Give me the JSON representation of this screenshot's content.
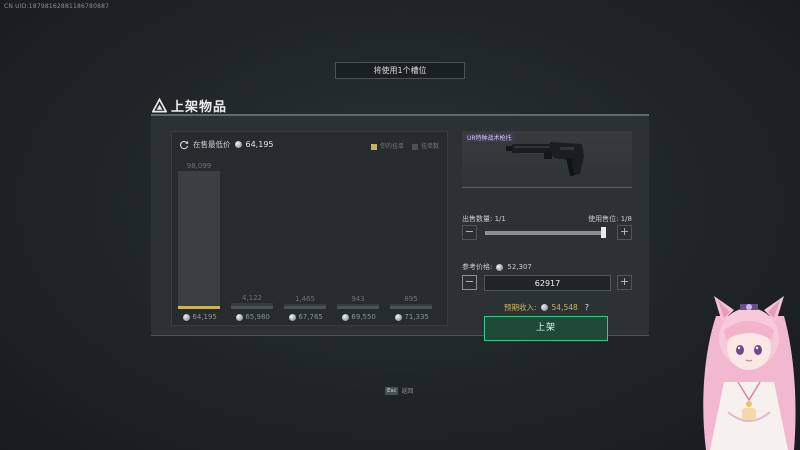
{
  "uid": "CN UID:18798162881186780887",
  "slot_notice": "将使用1个槽位",
  "panel_title": "上架物品",
  "chart": {
    "header_label": "在售最低价",
    "header_price": "64,195",
    "legend_own": "你的挂单",
    "legend_other": "挂单数",
    "bars": [
      {
        "count": "98,099",
        "price": "64,195",
        "own": true,
        "fill": 1.0
      },
      {
        "count": "4,122",
        "price": "65,980",
        "own": false,
        "fill": 0.042
      },
      {
        "count": "1,465",
        "price": "67,765",
        "own": false,
        "fill": 0.015
      },
      {
        "count": "943",
        "price": "69,550",
        "own": false,
        "fill": 0.01
      },
      {
        "count": "895",
        "price": "71,335",
        "own": false,
        "fill": 0.009
      }
    ]
  },
  "item": {
    "name": "UR特种战术枪托"
  },
  "sell_qty_label": "出售数量: 1/1",
  "use_slots_label": "使用售位: 1/8",
  "qty_level": 1.0,
  "ref_price_label": "参考价格:",
  "ref_price_value": "52,307",
  "price_input_value": "62917",
  "expected_label": "预期收入:",
  "expected_value": "54,548",
  "help_mark": "?",
  "list_button": "上架",
  "esc_key": "Esc",
  "esc_label": "返回",
  "colors": {
    "accent_green": "#38c88a",
    "own_bar_gold": "#c9b25a",
    "earn_gold": "#c9b45d"
  }
}
